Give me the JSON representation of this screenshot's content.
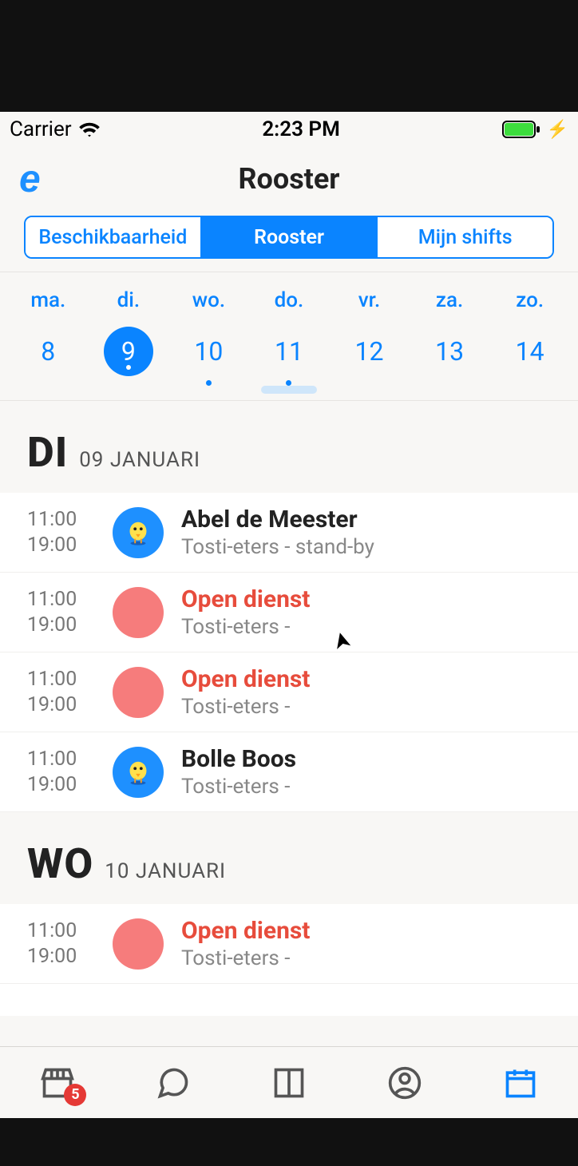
{
  "status_bar": {
    "carrier": "Carrier",
    "time": "2:23 PM"
  },
  "header": {
    "logo_letter": "e",
    "title": "Rooster"
  },
  "segments": [
    {
      "label": "Beschikbaarheid",
      "active": false
    },
    {
      "label": "Rooster",
      "active": true
    },
    {
      "label": "Mijn shifts",
      "active": false
    }
  ],
  "week": {
    "days": [
      {
        "label": "ma.",
        "num": "8",
        "selected": false,
        "has_dot": false
      },
      {
        "label": "di.",
        "num": "9",
        "selected": true,
        "has_dot": true
      },
      {
        "label": "wo.",
        "num": "10",
        "selected": false,
        "has_dot": true
      },
      {
        "label": "do.",
        "num": "11",
        "selected": false,
        "has_dot": true
      },
      {
        "label": "vr.",
        "num": "12",
        "selected": false,
        "has_dot": false
      },
      {
        "label": "za.",
        "num": "13",
        "selected": false,
        "has_dot": false
      },
      {
        "label": "zo.",
        "num": "14",
        "selected": false,
        "has_dot": false
      }
    ]
  },
  "sections": [
    {
      "big": "DI",
      "sub": "09 JANUARI",
      "shifts": [
        {
          "start": "11:00",
          "end": "19:00",
          "title": "Abel de Meester",
          "sub": "Tosti-eters - stand-by",
          "open": false,
          "avatar": "chick"
        },
        {
          "start": "11:00",
          "end": "19:00",
          "title": "Open dienst",
          "sub": "Tosti-eters -",
          "open": true,
          "avatar": "red"
        },
        {
          "start": "11:00",
          "end": "19:00",
          "title": "Open dienst",
          "sub": "Tosti-eters -",
          "open": true,
          "avatar": "red"
        },
        {
          "start": "11:00",
          "end": "19:00",
          "title": "Bolle Boos",
          "sub": "Tosti-eters -",
          "open": false,
          "avatar": "chick"
        }
      ]
    },
    {
      "big": "WO",
      "sub": "10 JANUARI",
      "shifts": [
        {
          "start": "11:00",
          "end": "19:00",
          "title": "Open dienst",
          "sub": "Tosti-eters -",
          "open": true,
          "avatar": "red"
        }
      ]
    }
  ],
  "tabbar": {
    "badge": "5"
  }
}
